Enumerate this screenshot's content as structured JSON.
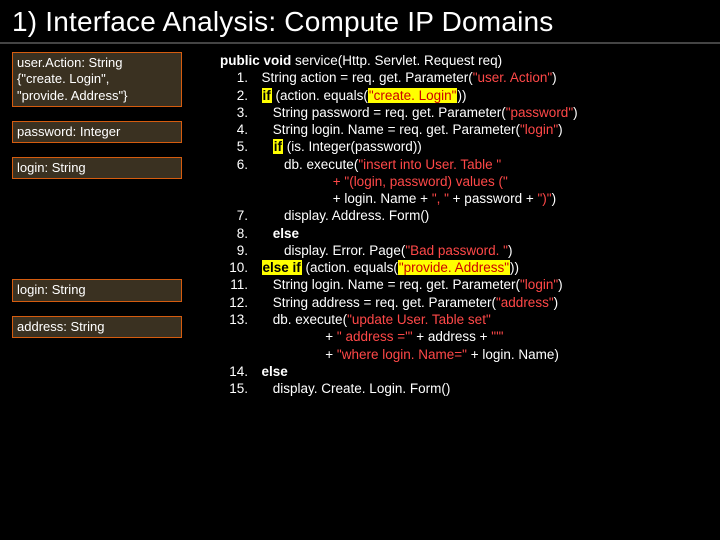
{
  "title": "1) Interface Analysis: Compute IP Domains",
  "left": {
    "box1_l1": "user.Action: String",
    "box1_l2": "{\"create. Login\",",
    "box1_l3": "\"provide. Address\"}",
    "box2": "password: Integer",
    "box3": "login: String",
    "box4": "login: String",
    "box5": "address: String"
  },
  "code": {
    "sig_pre": "public void",
    "sig_post": " service(Http. Servlet. Request req)",
    "l1a": "String action = req. get. Parameter(",
    "l1b": "\"user. Action\"",
    "l1c": ")",
    "l2a": " (action. equals(",
    "l2b": "\"create. Login\"",
    "l2c": "))",
    "l3a": "String password = req. get. Parameter(",
    "l3b": "\"password\"",
    "l3c": ")",
    "l4a": "String login. Name = req. get. Parameter(",
    "l4b": "\"login\"",
    "l4c": ")",
    "l5a": " (is. Integer(password))",
    "l6a": "db. execute(",
    "l6b": "\"insert into User. Table \"",
    "l6c": "+ \"(login, password) values (\"",
    "l6d": "+ login. Name + ",
    "l6e": "\", \"",
    "l6f": " + password + ",
    "l6g": "\")\"",
    "l6h": ")",
    "l7": "display. Address. Form()",
    "l8": "else",
    "l9a": "display. Error. Page(",
    "l9b": "\"Bad password. \"",
    "l9c": ")",
    "l10a": "else if",
    "l10b": " (action. equals(",
    "l10c": "\"provide. Address\"",
    "l10d": "))",
    "l11a": "String login. Name = req. get. Parameter(",
    "l11b": "\"login\"",
    "l11c": ")",
    "l12a": "String address = req. get. Parameter(",
    "l12b": "\"address\"",
    "l12c": ")",
    "l13a": "db. execute(",
    "l13b": "\"update User. Table set\"",
    "l13c": "+ ",
    "l13d": "\" address ='\"",
    "l13e": " + address + ",
    "l13f": "\"'\"",
    "l13g": "+ ",
    "l13h": "\"where login. Name=\"",
    "l13i": " + login. Name)",
    "l14": "else",
    "l15": "display. Create. Login. Form()",
    "n1": "1.",
    "n2": "2.",
    "n3": "3.",
    "n4": "4.",
    "n5": "5.",
    "n6": "6.",
    "n7": "7.",
    "n8": "8.",
    "n9": "9.",
    "n10": "10.",
    "n11": "11.",
    "n12": "12.",
    "n13": "13.",
    "n14": "14.",
    "n15": "15.",
    "kw_if": "if"
  }
}
